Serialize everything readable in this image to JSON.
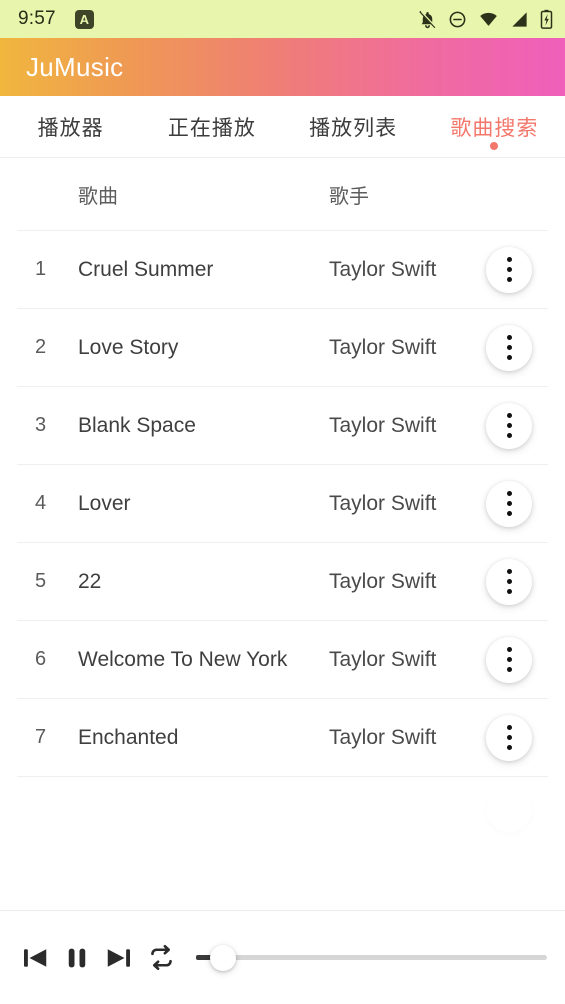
{
  "status_bar": {
    "time": "9:57",
    "app_badge_letter": "A",
    "icons": [
      "notifications-off-icon",
      "do-not-disturb-icon",
      "wifi-icon",
      "cellular-signal-icon",
      "battery-charging-icon"
    ]
  },
  "app_bar": {
    "title": "JuMusic",
    "gradient_start": "#f0b63e",
    "gradient_end": "#ef5fbb"
  },
  "tabs": {
    "active_index": 3,
    "active_color": "#f4776b",
    "items": [
      {
        "label": "播放器"
      },
      {
        "label": "正在播放"
      },
      {
        "label": "播放列表"
      },
      {
        "label": "歌曲搜索"
      }
    ]
  },
  "song_table": {
    "headers": {
      "index": "",
      "song": "歌曲",
      "artist": "歌手",
      "menu": ""
    },
    "rows": [
      {
        "index": "1",
        "song": "Cruel Summer",
        "artist": "Taylor Swift"
      },
      {
        "index": "2",
        "song": "Love Story",
        "artist": "Taylor Swift"
      },
      {
        "index": "3",
        "song": "Blank Space",
        "artist": "Taylor Swift"
      },
      {
        "index": "4",
        "song": "Lover",
        "artist": "Taylor Swift"
      },
      {
        "index": "5",
        "song": "22",
        "artist": "Taylor Swift"
      },
      {
        "index": "6",
        "song": "Welcome To New York",
        "artist": "Taylor Swift"
      },
      {
        "index": "7",
        "song": "Enchanted",
        "artist": "Taylor Swift"
      }
    ]
  },
  "player_bar": {
    "controls": [
      "previous-track-icon",
      "pause-icon",
      "next-track-icon",
      "repeat-icon"
    ],
    "progress_percent": 0,
    "progress_label": "-"
  }
}
